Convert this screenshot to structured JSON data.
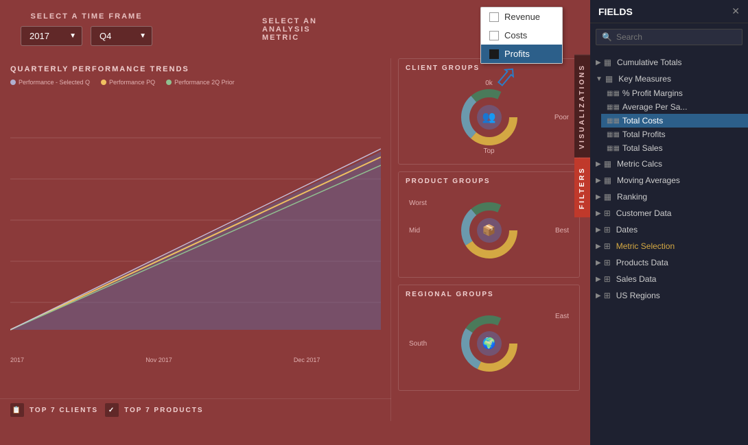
{
  "header": {
    "timeframe_label": "SELECT A TIME FRAME",
    "year_value": "2017",
    "quarter_value": "Q4",
    "metric_label": "SELECT AN\nANALYSIS\nMETRIC"
  },
  "metric_popup": {
    "items": [
      {
        "label": "Revenue",
        "checked": false,
        "selected": false
      },
      {
        "label": "Costs",
        "checked": false,
        "selected": false
      },
      {
        "label": "Profits",
        "checked": true,
        "selected": true
      }
    ]
  },
  "chart": {
    "title": "QUARTERLY PERFORMANCE TRENDS",
    "legend": [
      {
        "label": "Performance - Selected Q",
        "color": "#c0c0e0"
      },
      {
        "label": "Performance PQ",
        "color": "#f0c060"
      },
      {
        "label": "Performance 2Q Prior",
        "color": "#90c090"
      }
    ],
    "x_labels": [
      "2017",
      "",
      "Nov 2017",
      "",
      "Dec 2017",
      ""
    ]
  },
  "groups": [
    {
      "title": "CLIENT GROUPS",
      "labels": {
        "top": "0k",
        "right": "Poor",
        "bottom": "Top"
      }
    },
    {
      "title": "PRODUCT GROUPS",
      "labels": {
        "left": "Worst",
        "left2": "Mid",
        "right": "Best"
      }
    },
    {
      "title": "REGIONAL GROUPS",
      "labels": {
        "left": "South",
        "right": "East"
      }
    }
  ],
  "side_tabs": [
    {
      "label": "VISUALIZATIONS",
      "active": false
    },
    {
      "label": "FILTERS",
      "active": true
    }
  ],
  "bottom_items": [
    {
      "label": "TOP 7 CLIENTS"
    },
    {
      "label": "TOP 7 PRODUCTS"
    }
  ],
  "fields": {
    "title": "FIELDS",
    "search_placeholder": "Search",
    "items": [
      {
        "name": "Cumulative Totals",
        "expanded": false,
        "icon": "table",
        "children": []
      },
      {
        "name": "Key Measures",
        "expanded": true,
        "icon": "table",
        "children": [
          {
            "name": "% Profit Margins",
            "highlighted": false
          },
          {
            "name": "Average Per Sa...",
            "highlighted": false
          },
          {
            "name": "Total Costs",
            "highlighted": true
          },
          {
            "name": "Total Profits",
            "highlighted": false
          },
          {
            "name": "Total Sales",
            "highlighted": false
          }
        ]
      },
      {
        "name": "Metric Calcs",
        "expanded": false,
        "icon": "table",
        "children": []
      },
      {
        "name": "Moving Averages",
        "expanded": false,
        "icon": "table",
        "children": []
      },
      {
        "name": "Ranking",
        "expanded": false,
        "icon": "table",
        "children": []
      },
      {
        "name": "Customer Data",
        "expanded": false,
        "icon": "grid",
        "children": []
      },
      {
        "name": "Dates",
        "expanded": false,
        "icon": "grid",
        "children": []
      },
      {
        "name": "Metric Selection",
        "expanded": false,
        "icon": "grid",
        "gold": true,
        "children": []
      },
      {
        "name": "Products Data",
        "expanded": false,
        "icon": "grid",
        "children": []
      },
      {
        "name": "Sales Data",
        "expanded": false,
        "icon": "grid",
        "children": []
      },
      {
        "name": "US Regions",
        "expanded": false,
        "icon": "grid",
        "children": []
      }
    ]
  }
}
